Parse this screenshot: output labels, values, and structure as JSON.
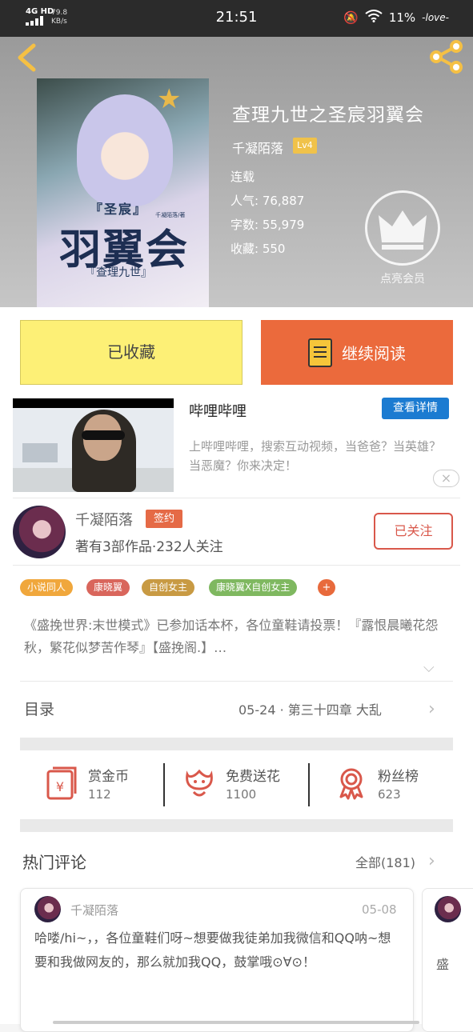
{
  "status": {
    "network": "4G HD",
    "speed": "79.8",
    "speed_unit": "KB/s",
    "time": "21:51",
    "battery": "11%",
    "carrier": "-love-"
  },
  "book": {
    "title": "查理九世之圣宸羽翼会",
    "author": "千凝陌落",
    "level": "Lv4",
    "state": "连载",
    "popularity": "人气: 76,887",
    "words": "字数: 55,979",
    "favorites": "收藏: 550",
    "vip_label": "点亮会员",
    "cover_text": {
      "t1": "『圣宸』",
      "t2": "羽翼会",
      "t3": "『查理九世』",
      "t4": "千凝陌落/著"
    }
  },
  "actions": {
    "collected": "已收藏",
    "continue_read": "继续阅读"
  },
  "ad": {
    "title": "哔哩哔哩",
    "detail_button": "查看详情",
    "description": "上哔哩哔哩，搜索互动视频，当爸爸？当英雄？当恶魔？你来决定！",
    "close": "×"
  },
  "author_card": {
    "name": "千凝陌落",
    "badge": "签约",
    "summary": "著有3部作品·232人关注",
    "follow_button": "已关注"
  },
  "tags": [
    {
      "label": "小说同人",
      "color": "#f0a73c"
    },
    {
      "label": "康晓翼",
      "color": "#d9665c"
    },
    {
      "label": "自创女主",
      "color": "#c89a43"
    },
    {
      "label": "康晓翼X自创女主",
      "color": "#7fb860"
    }
  ],
  "tag_plus": "+",
  "intro": "《盛挽世界:末世模式》已参加话本杯，各位童鞋请投票！『露恨晨曦花怨秋，繁花似梦苦作琴』【盛挽阁.】…",
  "toc": {
    "label": "目录",
    "latest": "05-24 · 第三十四章 大乱"
  },
  "rewards": [
    {
      "label": "赏金币",
      "value": "112",
      "icon": "coin-envelope-icon"
    },
    {
      "label": "免费送花",
      "value": "1100",
      "icon": "flower-icon"
    },
    {
      "label": "粉丝榜",
      "value": "623",
      "icon": "medal-icon"
    }
  ],
  "comments": {
    "header": "热门评论",
    "all": "全部(181)",
    "items": [
      {
        "user": "千凝陌落",
        "date": "05-08",
        "text": "哈喽/hi~，，各位童鞋们呀~想要做我徒弟加我微信和QQ呐~想要和我做网友的，那么就加我QQ，鼓掌哦⊙∀⊙！"
      }
    ],
    "peek_text": "盛"
  },
  "colors": {
    "accent_orange": "#eb6a3c",
    "collected_yellow": "#fdf076",
    "detail_blue": "#1b7bd1",
    "follow_red": "#d9584b"
  }
}
